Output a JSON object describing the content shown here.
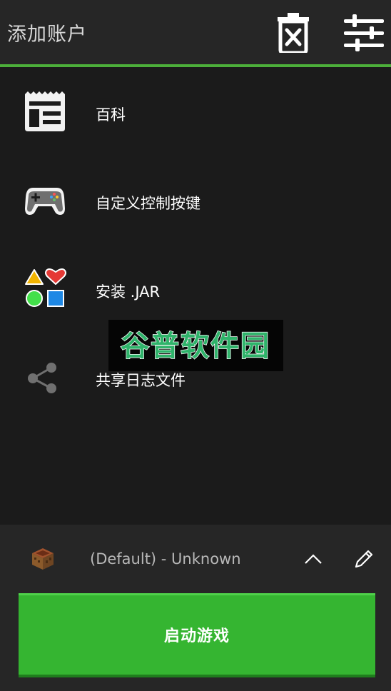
{
  "topbar": {
    "title": "添加账户",
    "trash_icon": "delete-icon",
    "settings_icon": "sliders-icon",
    "accent_color": "#4caf3a"
  },
  "menu": {
    "items": [
      {
        "label": "百科",
        "icon": "newspaper-icon"
      },
      {
        "label": "自定义控制按键",
        "icon": "gamepad-icon"
      },
      {
        "label": "安装 .JAR",
        "icon": "shapes-icon"
      },
      {
        "label": "共享日志文件",
        "icon": "share-icon"
      }
    ]
  },
  "watermark": {
    "text": "谷普软件园"
  },
  "bottom": {
    "version_label": "(Default) - Unknown",
    "version_icon": "crafting-table-icon",
    "chevron_icon": "chevron-up-icon",
    "edit_icon": "pencil-icon",
    "launch_label": "启动游戏",
    "launch_color": "#35b531"
  }
}
